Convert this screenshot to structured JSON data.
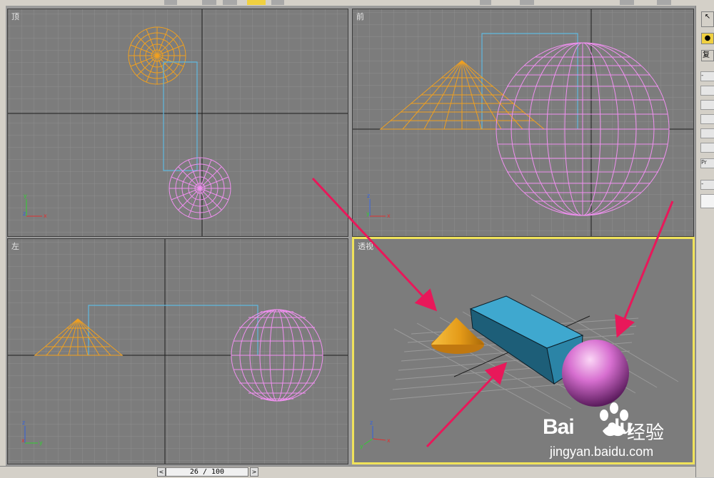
{
  "viewports": {
    "top": {
      "label": "顶"
    },
    "front": {
      "label": "前"
    },
    "left": {
      "label": "左"
    },
    "perspective": {
      "label": "透视"
    }
  },
  "axes": {
    "x": "x",
    "y": "y",
    "z": "z"
  },
  "colors": {
    "cone": "#f0a020",
    "sphere": "#f090f0",
    "box_outline": "#60b8e0",
    "active_border": "#f0e25a",
    "arrow": "#e8185a",
    "viewport_bg": "#7c7c7c"
  },
  "right_panel": {
    "buttons": [
      "复",
      "Pr"
    ]
  },
  "timeline": {
    "frame": "26 / 100",
    "prev_icon": "chevron-left-icon",
    "next_icon": "chevron-right-icon"
  },
  "watermark": {
    "logo": "Bai",
    "logo_suffix": "du",
    "text": "经验",
    "url": "jingyan.baidu.com"
  }
}
